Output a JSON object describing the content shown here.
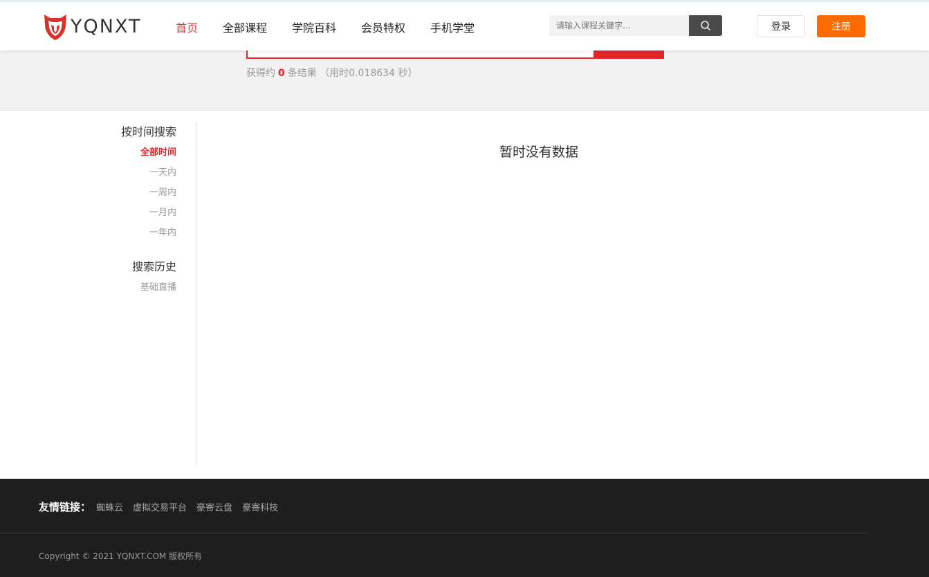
{
  "header": {
    "logo_text": "YQNXT",
    "nav": [
      {
        "label": "首页",
        "active": true
      },
      {
        "label": "全部课程",
        "active": false
      },
      {
        "label": "学院百科",
        "active": false
      },
      {
        "label": "会员特权",
        "active": false
      },
      {
        "label": "手机学堂",
        "active": false
      }
    ],
    "search_placeholder": "请输入课程关键字...",
    "login_label": "登录",
    "register_label": "注册"
  },
  "results": {
    "prefix": "获得约",
    "count": "0",
    "suffix": "条结果 （用时0.018634 秒）",
    "empty_message": "暂时没有数据"
  },
  "sidebar": {
    "time_title": "按时间搜索",
    "time_filters": [
      {
        "label": "全部时间",
        "active": true
      },
      {
        "label": "一天内",
        "active": false
      },
      {
        "label": "一周内",
        "active": false
      },
      {
        "label": "一月内",
        "active": false
      },
      {
        "label": "一年内",
        "active": false
      }
    ],
    "history_title": "搜索历史",
    "history_items": [
      "基础直播"
    ]
  },
  "footer": {
    "links_label": "友情链接：",
    "links": [
      "蜘蛛云",
      "虚拟交易平台",
      "豪寄云盘",
      "豪寄科技"
    ],
    "copyright": "Copyright © 2021 YQNXT.COM 版权所有"
  },
  "colors": {
    "accent_red": "#e4262b",
    "register_orange": "#ff6a00",
    "footer_bg": "#1e1e1e"
  }
}
